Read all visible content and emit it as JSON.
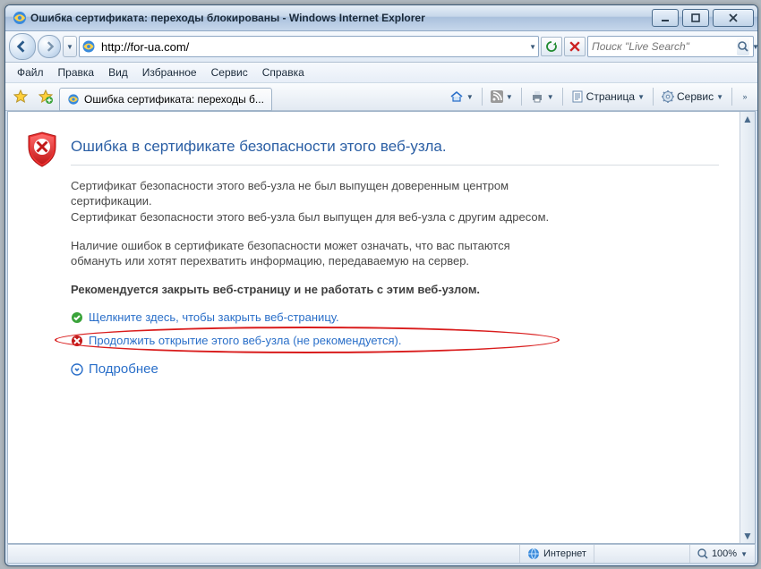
{
  "window": {
    "title": "Ошибка сертификата: переходы блокированы - Windows Internet Explorer"
  },
  "address": {
    "url": "http://for-ua.com/"
  },
  "search": {
    "placeholder": "Поиск \"Live Search\""
  },
  "menu": [
    "Файл",
    "Правка",
    "Вид",
    "Избранное",
    "Сервис",
    "Справка"
  ],
  "tab": {
    "label": "Ошибка сертификата: переходы б..."
  },
  "cmd": {
    "page": "Страница",
    "tools": "Сервис"
  },
  "cert": {
    "heading": "Ошибка в сертификате безопасности этого веб-узла.",
    "p1": "Сертификат безопасности этого веб-узла не был выпущен доверенным центром сертификации.",
    "p2": "Сертификат безопасности этого веб-узла был выпущен для веб-узла с другим адресом.",
    "p3": "Наличие ошибок в сертификате безопасности может означать, что вас пытаются обмануть или хотят перехватить информацию, передаваемую на сервер.",
    "p4": "Рекомендуется закрыть веб-страницу и не работать с этим веб-узлом.",
    "close_link": "Щелкните здесь, чтобы закрыть веб-страницу.",
    "continue_link": "Продолжить открытие этого веб-узла (не рекомендуется).",
    "more_link": "Подробнее"
  },
  "status": {
    "zone": "Интернет",
    "zoom": "100%"
  }
}
